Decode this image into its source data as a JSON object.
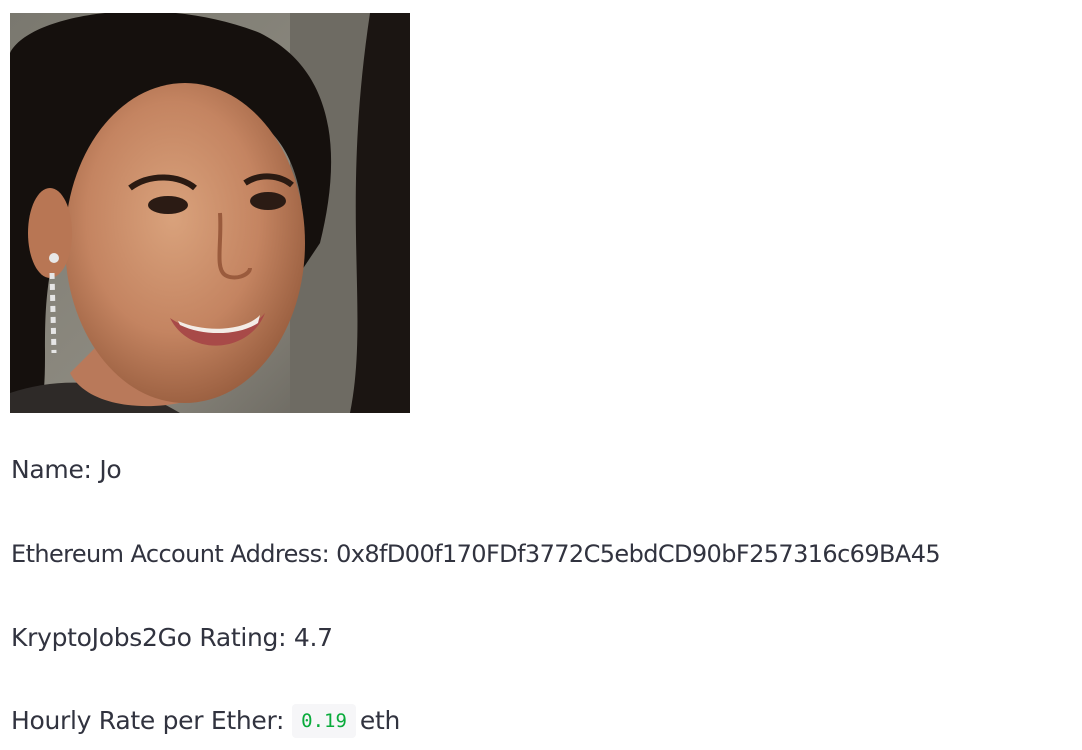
{
  "profile": {
    "name_label": "Name:",
    "name_value": "Jo",
    "address_label": "Ethereum Account Address:",
    "address_value": "0x8fD00f170FDf3772C5ebdCD90bF257316c69BA45",
    "rating_label": "KryptoJobs2Go Rating:",
    "rating_value": "4.7",
    "rate_label": "Hourly Rate per Ether:",
    "rate_value": "0.19",
    "rate_unit": "eth"
  },
  "colors": {
    "text": "#31333f",
    "code_text": "#09ab3b",
    "code_background": "#f6f6f8"
  },
  "icons": {
    "photo": "candidate-portrait-photo"
  }
}
